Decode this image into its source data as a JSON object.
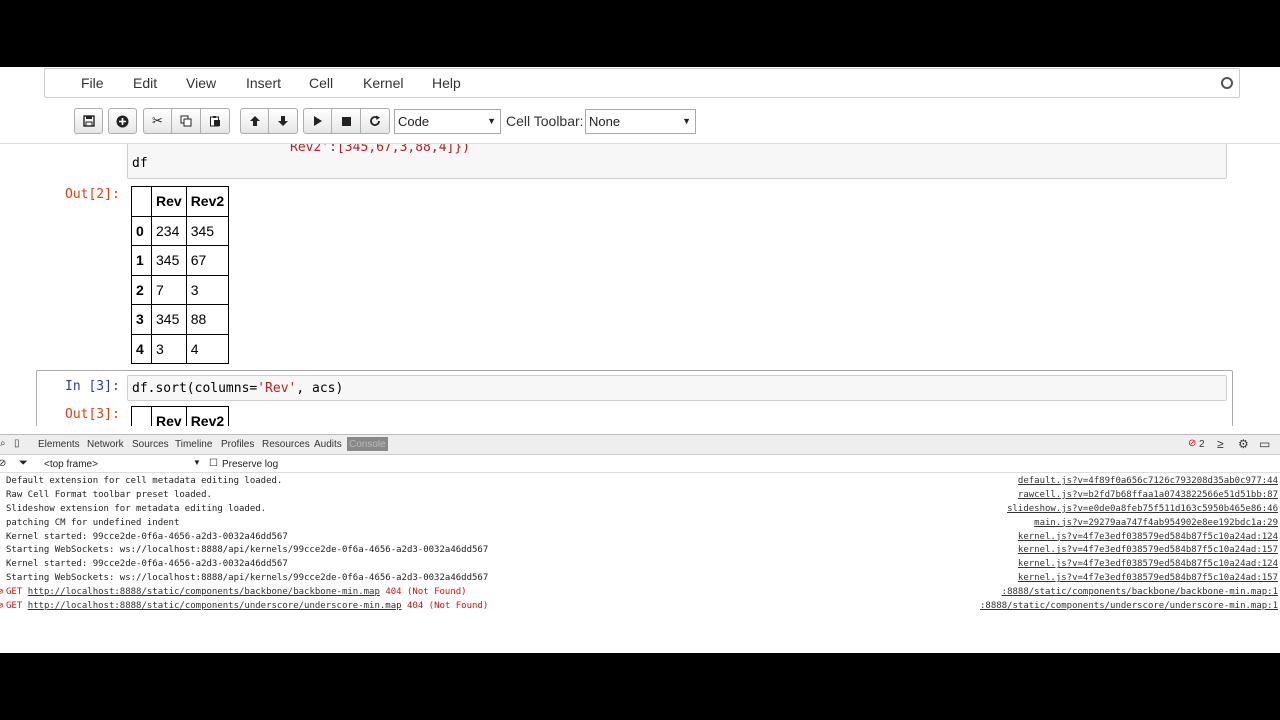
{
  "menubar": {
    "items": [
      "File",
      "Edit",
      "View",
      "Insert",
      "Cell",
      "Kernel",
      "Help"
    ]
  },
  "toolbar": {
    "cell_type": "Code",
    "cell_toolbar_label": "Cell Toolbar:",
    "cell_toolbar_value": "None"
  },
  "cell2": {
    "code_line_partial": "Rev2':[345,67,3,88,4]})",
    "code_line_last": "df",
    "out_prompt": "Out[2]:",
    "table": {
      "columns": [
        "",
        "Rev",
        "Rev2"
      ],
      "rows": [
        [
          "0",
          "234",
          "345"
        ],
        [
          "1",
          "345",
          "67"
        ],
        [
          "2",
          "7",
          "3"
        ],
        [
          "3",
          "345",
          "88"
        ],
        [
          "4",
          "3",
          "4"
        ]
      ]
    }
  },
  "cell3": {
    "in_prompt": "In [3]:",
    "code": {
      "prefix": "df.sort(columns=",
      "string": "'Rev'",
      "suffix": ", acs)"
    },
    "out_prompt": "Out[3]:",
    "table_header_partial": [
      "Rev",
      "Rev2"
    ]
  },
  "devtools": {
    "tabs": [
      "Elements",
      "Network",
      "Sources",
      "Timeline",
      "Profiles",
      "Resources",
      "Audits",
      "Console"
    ],
    "error_count": "2",
    "frame": "<top frame>",
    "preserve_log": "Preserve log",
    "logs": [
      {
        "msg": "Default extension for cell metadata editing loaded.",
        "src": "default.js?v=4f89f0a656c7126c793208d35ab0c977:44"
      },
      {
        "msg": "Raw Cell Format toolbar preset loaded.",
        "src": "rawcell.js?v=b2fd7b68ffaa1a0743822566e51d51bb:87"
      },
      {
        "msg": "Slideshow extension for metadata editing loaded.",
        "src": "slideshow.js?v=e0de0a8feb75f511d163c5950b465e86:46"
      },
      {
        "msg": "patching CM for undefined indent",
        "src": "main.js?v=29279aa747f4ab954902e8ee192bdc1a:29"
      },
      {
        "msg": "Kernel started:  99cce2de-0f6a-4656-a2d3-0032a46dd567",
        "src": "kernel.js?v=4f7e3edf038579ed584b87f5c10a24ad:124"
      },
      {
        "msg": "Starting WebSockets: ws://localhost:8888/api/kernels/99cce2de-0f6a-4656-a2d3-0032a46dd567",
        "src": "kernel.js?v=4f7e3edf038579ed584b87f5c10a24ad:157"
      },
      {
        "msg": "Kernel started:  99cce2de-0f6a-4656-a2d3-0032a46dd567",
        "src": "kernel.js?v=4f7e3edf038579ed584b87f5c10a24ad:124"
      },
      {
        "msg": "Starting WebSockets: ws://localhost:8888/api/kernels/99cce2de-0f6a-4656-a2d3-0032a46dd567",
        "src": "kernel.js?v=4f7e3edf038579ed584b87f5c10a24ad:157"
      }
    ],
    "errors": [
      {
        "method": "GET",
        "url": "http://localhost:8888/static/components/backbone/backbone-min.map",
        "status": "404 (Not Found)",
        "src": ":8888/static/components/backbone/backbone-min.map:1"
      },
      {
        "method": "GET",
        "url": "http://localhost:8888/static/components/underscore/underscore-min.map",
        "status": "404 (Not Found)",
        "src": ":8888/static/components/underscore/underscore-min.map:1"
      }
    ]
  }
}
